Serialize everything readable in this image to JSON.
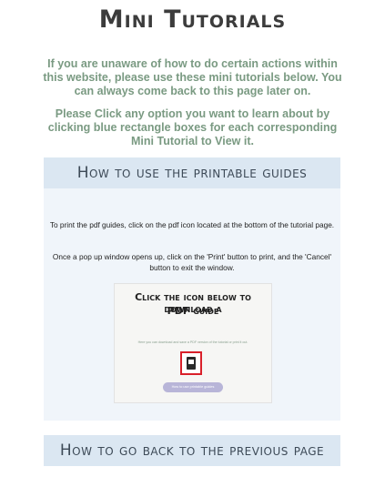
{
  "page": {
    "title": "Mini Tutorials",
    "intro_1": "If you are unaware of how to do certain actions within this website, please use these mini tutorials below. You can always come back to this page later on.",
    "intro_2": "Please Click any option you want to learn about by clicking blue rectangle boxes for each corresponding Mini Tutorial to View it."
  },
  "tutorials": [
    {
      "label": "How to use the printable guides",
      "text_1": "To print the pdf guides, click on the pdf icon located at the bottom of the tutorial page.",
      "text_2": "Once a pop up window opens up, click on the 'Print' button to print, and the 'Cancel' button to exit the window.",
      "image": {
        "heading_1": "Click the icon below to download a",
        "heading_2": "PDF guide",
        "small_text": "Here you can download and save a PDF version of the tutorial or print it out.",
        "button_label": "How to use printable guides",
        "icon": "pdf-icon",
        "highlight_color": "#d9202a"
      }
    },
    {
      "label": "How to go back to the previous page"
    }
  ],
  "colors": {
    "title": "#3c3c3c",
    "intro_text": "#7a9a82",
    "accordion_header": "#dbe7f2",
    "accordion_panel": "#f0f5fa"
  }
}
